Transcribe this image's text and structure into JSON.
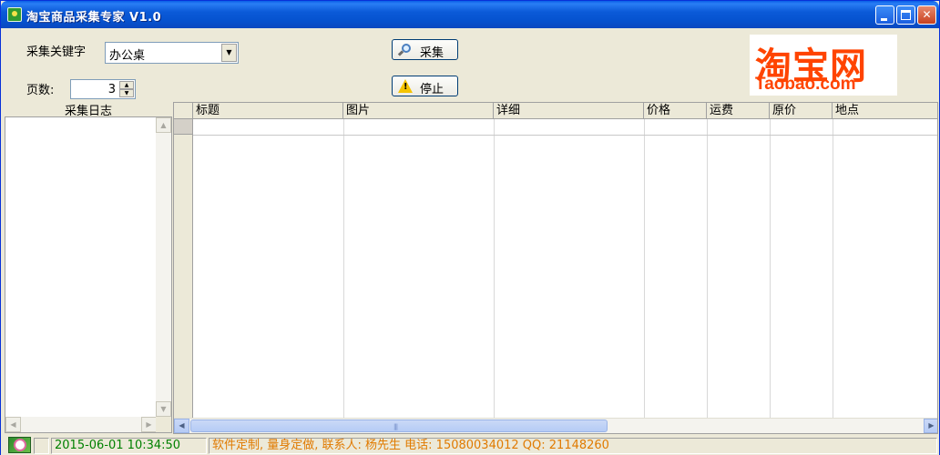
{
  "window": {
    "title": "淘宝商品采集专家 V1.0",
    "min_glyph": "",
    "max_glyph": "",
    "close_glyph": "✕"
  },
  "form": {
    "keyword_label": "采集关键字",
    "keyword_value": "办公桌",
    "pages_label": "页数:",
    "pages_value": "3",
    "collect_button": "采集",
    "stop_button": "停止"
  },
  "logo": {
    "cn": "淘宝网",
    "en": "Taobao.com"
  },
  "log": {
    "title": "采集日志"
  },
  "grid": {
    "columns": [
      "标题",
      "图片",
      "详细",
      "价格",
      "运费",
      "原价",
      "地点"
    ]
  },
  "status": {
    "datetime": "2015-06-01 10:34:50",
    "message": "软件定制, 量身定做, 联系人: 杨先生 电话: 15080034012  QQ: 21148260"
  },
  "colors": {
    "titlebar": "#0653d0",
    "status_datetime": "#008000",
    "status_message": "#e07a00",
    "logo_orange": "#ff4400"
  },
  "icons": {
    "collect": "search-icon",
    "stop": "warning-icon",
    "app": "app-icon"
  }
}
